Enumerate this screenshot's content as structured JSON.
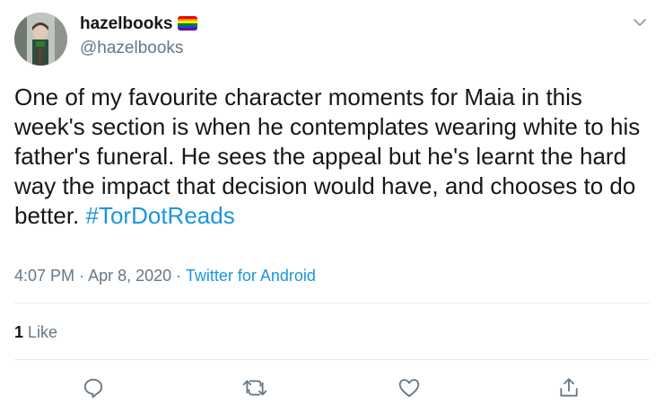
{
  "author": {
    "display_name": "hazelbooks",
    "handle": "@hazelbooks",
    "avatar_icon": "profile-photo",
    "flag_icon": "rainbow-flag-emoji",
    "flag_colors": [
      "#e40303",
      "#ff8c00",
      "#ffed00",
      "#008026",
      "#004dff",
      "#750787"
    ]
  },
  "tweet": {
    "text": "One of my favourite character moments for Maia in this week's section is when he contemplates wearing white to his father's funeral. He sees the appeal but he's learnt the hard way the impact that decision would have, and chooses to do better.",
    "hashtag": "#TorDotReads",
    "time": "4:07 PM",
    "date": "Apr 8, 2020",
    "separator": "·",
    "source": "Twitter for Android"
  },
  "stats": {
    "like_count": "1",
    "like_label": "Like"
  },
  "actions": {
    "reply_icon": "reply-icon",
    "retweet_icon": "retweet-icon",
    "like_icon": "like-icon",
    "share_icon": "share-icon"
  },
  "colors": {
    "link": "#1b95e0",
    "secondary_text": "#657786",
    "divider": "#e6ecf0",
    "icon": "#657786"
  }
}
